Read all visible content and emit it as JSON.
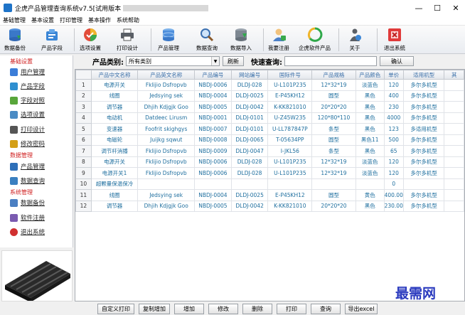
{
  "window": {
    "title": "企虎产品管理查询系统v7.5[试用版本",
    "min_glyph": "—",
    "max_glyph": "☐",
    "close_glyph": "✕"
  },
  "menu": [
    "基础管理",
    "基本设置",
    "打印管理",
    "基本操作",
    "系统帮助"
  ],
  "toolbar": [
    {
      "label": "数据备份",
      "icon": "database-backup-icon"
    },
    {
      "label": "产品字段",
      "icon": "product-field-icon"
    },
    {
      "label": "选项设置",
      "icon": "options-icon"
    },
    {
      "label": "打印设计",
      "icon": "printer-icon"
    },
    {
      "label": "产品管理",
      "icon": "database-icon"
    },
    {
      "label": "数据查询",
      "icon": "magnifier-icon"
    },
    {
      "label": "数据导入",
      "icon": "database-import-icon"
    },
    {
      "label": "我要注册",
      "icon": "user-register-icon"
    },
    {
      "label": "企虎软件产品",
      "icon": "recycle-arrows-icon"
    },
    {
      "label": "关于",
      "icon": "about-icon"
    },
    {
      "label": "退出系统",
      "icon": "exit-icon"
    }
  ],
  "search": {
    "category_label": "产品类别:",
    "category_value": "所有类别",
    "refresh_label": "刷新",
    "quick_label": "快速查询:",
    "quick_value": "",
    "confirm_label": "确认"
  },
  "sidebar": {
    "groups": [
      {
        "title": "基础设置",
        "items": [
          {
            "label": "用户管理",
            "icon": "user-icon",
            "color": "#3b7dd8"
          },
          {
            "label": "产品字段",
            "icon": "field-icon",
            "color": "#2f8fd0"
          },
          {
            "label": "字段对照",
            "icon": "compare-icon",
            "color": "#58a63a"
          },
          {
            "label": "选项设置",
            "icon": "options-icon",
            "color": "#4a8bc4"
          },
          {
            "label": "打印设计",
            "icon": "printer-icon",
            "color": "#555555"
          },
          {
            "label": "修改密码",
            "icon": "key-icon",
            "color": "#d4a017"
          }
        ]
      },
      {
        "title": "数据管理",
        "items": [
          {
            "label": "产品管理",
            "icon": "database-icon",
            "color": "#2e6fb8"
          },
          {
            "label": "数据查询",
            "icon": "search-icon",
            "color": "#3a7fc0"
          }
        ]
      },
      {
        "title": "系统管理",
        "items": [
          {
            "label": "数据备份",
            "icon": "backup-icon",
            "color": "#4b7fc2"
          },
          {
            "label": "软件注册",
            "icon": "register-icon",
            "color": "#7a5bb0"
          },
          {
            "label": "退出系统",
            "icon": "exit-icon",
            "color": "#d03030"
          }
        ]
      }
    ]
  },
  "grid": {
    "columns": [
      "产品中文名称",
      "产品英文名称",
      "产品编号",
      "网站编号",
      "国际件号",
      "产品规格",
      "产品颜色",
      "单价",
      "适用机型",
      "其"
    ],
    "rows": [
      [
        "1",
        "电源开关",
        "Fklijio Dsfropvb",
        "NBDJ-0006",
        "DLDJ-028",
        "U-L101P235",
        "12*32*19",
        "淡蓝色",
        "120",
        "多尔多机型",
        ""
      ],
      [
        "2",
        "线圈",
        "Jedsying sek",
        "NBDJ-0004",
        "DLDJ-0025",
        "E-P45KH12",
        "圆型",
        "黑色",
        "400",
        "多尔多机型",
        ""
      ],
      [
        "3",
        "调节器",
        "Dhjih Kdjgjk Goo",
        "NBDJ-0005",
        "DLDJ-0042",
        "K-KK821010",
        "20*20*20",
        "黑色",
        "230",
        "多尔多机型",
        ""
      ],
      [
        "4",
        "电动机",
        "Datdeec Lirusm",
        "NBDJ-0001",
        "DLDJ-0101",
        "U-Z45W235",
        "120*80*110",
        "黑色",
        "4000",
        "多尔多机型",
        ""
      ],
      [
        "5",
        "变速器",
        "Foofrit skighgys",
        "NBDJ-0007",
        "DLDJ-0101",
        "U-LL787847P",
        "条型",
        "黑色",
        "123",
        "多适用机型",
        ""
      ],
      [
        "6",
        "电磁轮",
        "Juijkg sqwut",
        "NBDJ-0008",
        "DLDJ-0065",
        "T-05634PP",
        "圆型",
        "黑色11",
        "500",
        "多尔多机型",
        ""
      ],
      [
        "7",
        "调节杆消播",
        "Fklijio Dsfropvb",
        "NBDJ-0009",
        "DLDJ-0047",
        "I-JKL56",
        "条型",
        "黑色",
        "65",
        "多尔多机型",
        ""
      ],
      [
        "8",
        "电源开关",
        "Fklijio Dsfropvb",
        "NBDJ-0006",
        "DLDJ-028",
        "U-L101P235",
        "12*32*19",
        "淡蓝色",
        "120",
        "多尔多机型",
        ""
      ],
      [
        "9",
        "电源开关1",
        "Fklijio Dsfropvb",
        "NBDJ-0006",
        "DLDJ-028",
        "U-L101P235",
        "12*32*19",
        "淡蓝色",
        "120",
        "多尔多机型",
        ""
      ],
      [
        "10",
        "超颗量保温保冷",
        "",
        "",
        "",
        "",
        "",
        "",
        "0",
        "",
        ""
      ],
      [
        "11",
        "线圈",
        "Jedsying sek",
        "NBDJ-0004",
        "DLDJ-0025",
        "E-P45KH12",
        "圆型",
        "黄色",
        "400.00",
        "多尔多机型",
        ""
      ],
      [
        "12",
        "调节器",
        "Dhjih Kdjgjk Goo",
        "NBDJ-0005",
        "DLDJ-0042",
        "K-KK821010",
        "20*20*20",
        "黑色",
        "230.00",
        "多尔多机型",
        ""
      ]
    ]
  },
  "bottom_buttons": [
    "自定义打印",
    "复制增加",
    "增加",
    "修改",
    "删除",
    "打印",
    "查询",
    "导出excel"
  ],
  "watermark": "最需网"
}
